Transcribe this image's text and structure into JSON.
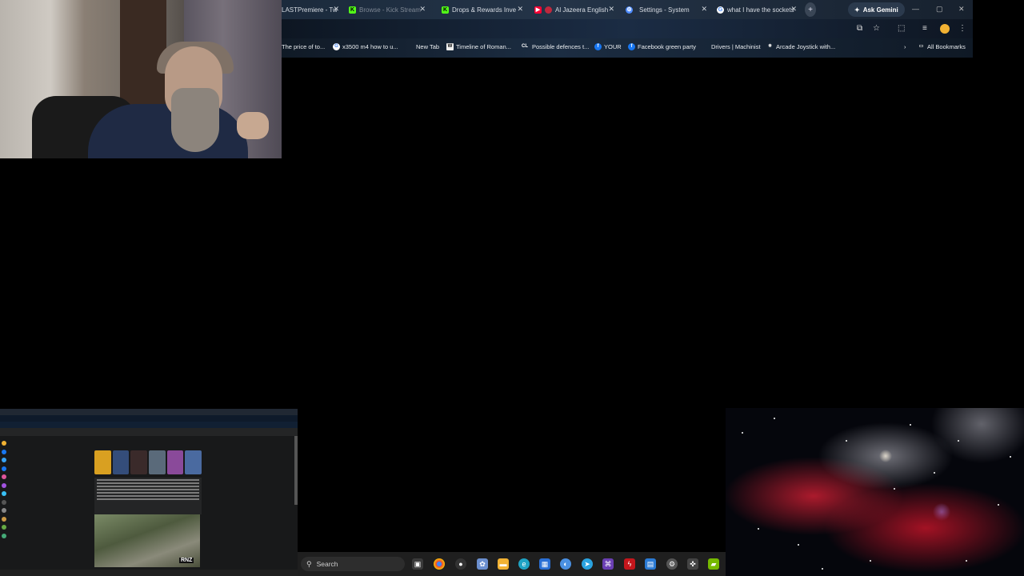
{
  "browser": {
    "tabs": [
      {
        "title": "LASTPremiere - Tw",
        "favicon": "generic",
        "color": "#8b5cf6"
      },
      {
        "title": "Browse - Kick Stream",
        "favicon": "K",
        "color": "#53fc18"
      },
      {
        "title": "Drops & Rewards Inve",
        "favicon": "K",
        "color": "#53fc18"
      },
      {
        "title": "Al Jazeera English",
        "favicon": "youtube",
        "color": "#ff0033"
      },
      {
        "title": "Settings - System",
        "favicon": "gear",
        "color": "#4f8cff"
      },
      {
        "title": "what I have the sockets",
        "favicon": "G",
        "color": "#ffffff"
      }
    ],
    "ask_gemini": "Ask Gemini",
    "bookmarks": [
      {
        "label": "The price of to...",
        "icon": "none"
      },
      {
        "label": "x3500 m4 how to u...",
        "icon": "G"
      },
      {
        "label": "New Tab",
        "icon": "none"
      },
      {
        "label": "Timeline of Roman...",
        "icon": "W"
      },
      {
        "label": "Possible defences t...",
        "icon": "CL"
      },
      {
        "label": "YOUR",
        "icon": "f"
      },
      {
        "label": "Facebook green party",
        "icon": "f"
      },
      {
        "label": "Drivers | Machinist",
        "icon": "none"
      },
      {
        "label": "Arcade Joystick with...",
        "icon": "star"
      }
    ],
    "all_bookmarks": "All Bookmarks"
  },
  "taskbar": {
    "search_placeholder": "Search",
    "apps": [
      "task-view",
      "chrome",
      "obs",
      "app3",
      "file-explorer",
      "edge",
      "store",
      "telegram",
      "visual-studio",
      "flash",
      "app10",
      "settings",
      "controller",
      "nvidia"
    ]
  },
  "thumbnail": {
    "rnz_label": "RNZ"
  }
}
